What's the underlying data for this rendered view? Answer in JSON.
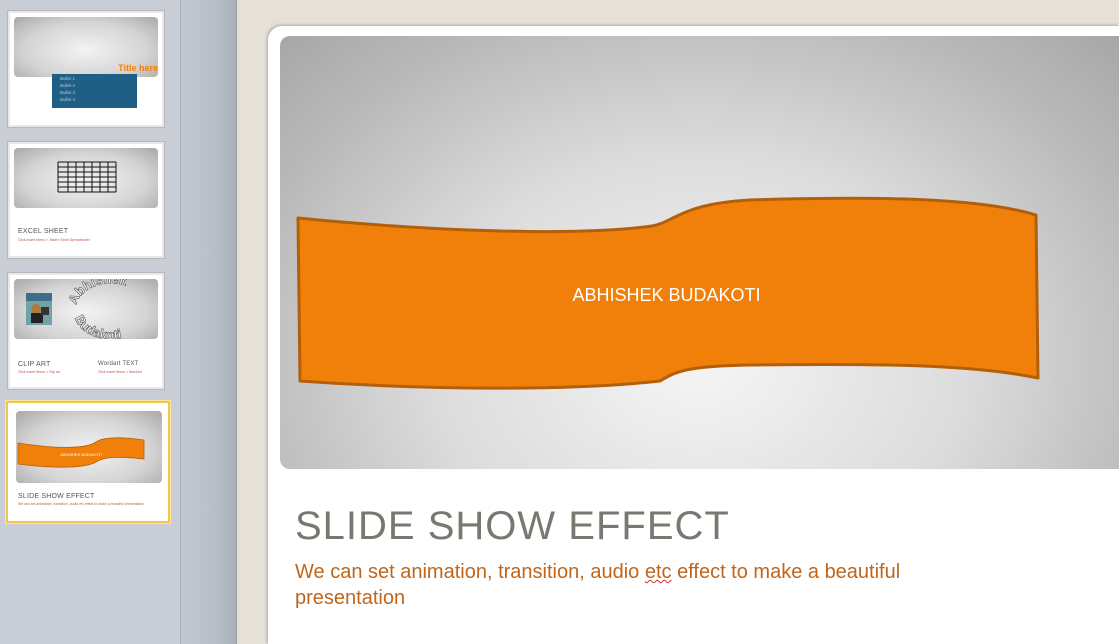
{
  "thumbnails": [
    {
      "title_text": "Title here",
      "bullets": [
        "Bullet 1",
        "Bullet 2",
        "Bullet 3",
        "Bullet 4"
      ],
      "selected": false
    },
    {
      "caption": "EXCEL SHEET",
      "sub": "Click Insert Menu > Table> Excel Spreadsheet",
      "selected": false
    },
    {
      "caption_left": "CLIP ART",
      "sub_left": "Click Insert Menu > Clip art",
      "caption_right": "Wordart TEXT",
      "sub_right": "Click Insert Menu > WordArt",
      "wordart_top": "Abhishek",
      "wordart_bottom": "Budakoti",
      "selected": false
    },
    {
      "banner_text": "ABHISHEK BUDAKOTI",
      "caption": "SLIDE SHOW EFFECT",
      "sub": "We can set animation, transition, audio etc effect to make a beautiful presentation",
      "selected": true
    }
  ],
  "slide": {
    "banner_text": "ABHISHEK BUDAKOTI",
    "title": "SLIDE SHOW EFFECT",
    "subtitle_before": "We can set animation, transition, audio ",
    "subtitle_misspelled": "etc",
    "subtitle_after": " effect to make a beautiful presentation"
  },
  "colors": {
    "accent_orange": "#f0800a",
    "banner_stroke": "#b35f0a",
    "title_gray": "#7a7670",
    "subtitle_orange": "#c0651a",
    "selection_yellow": "#f2c64a"
  }
}
